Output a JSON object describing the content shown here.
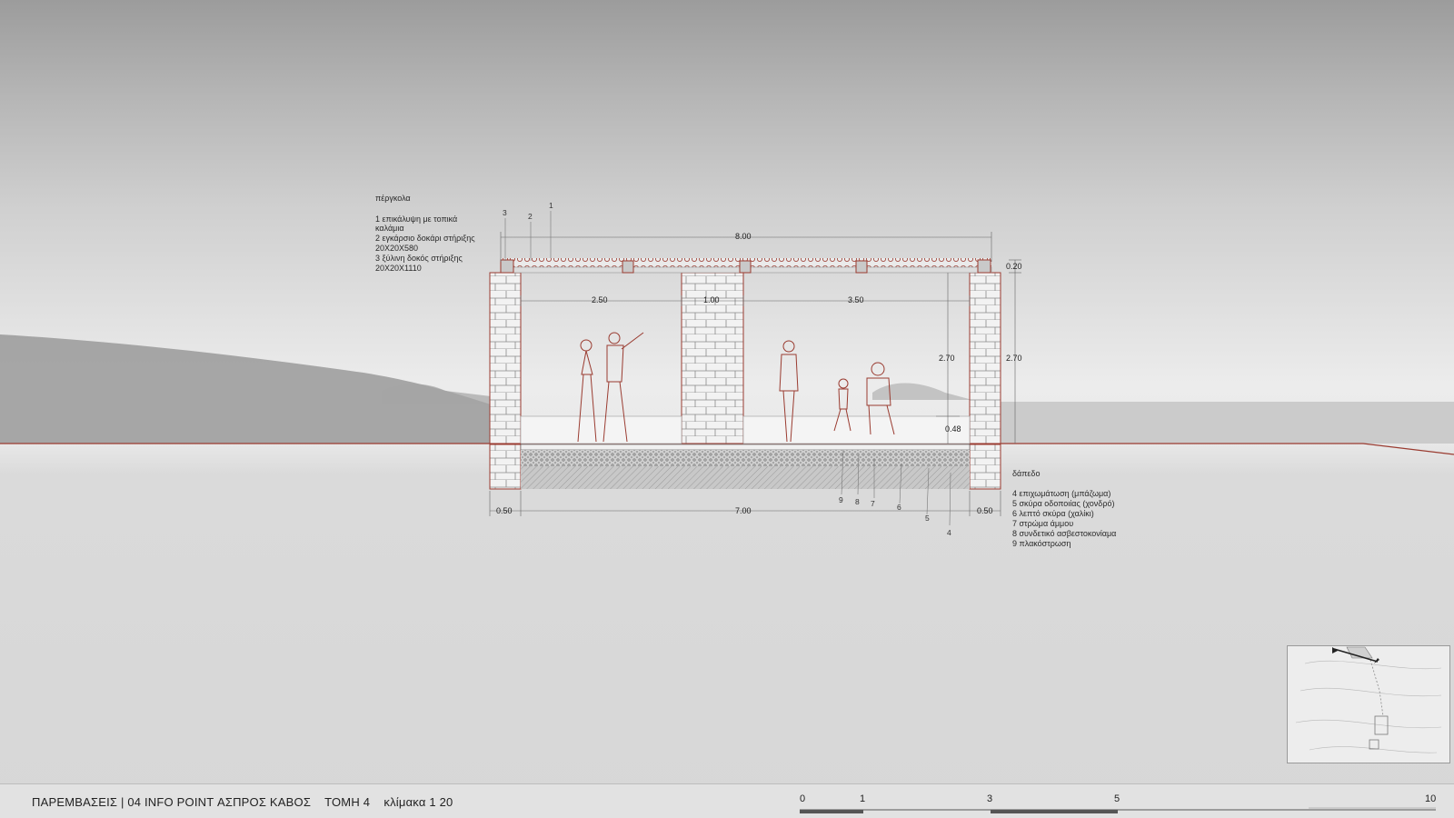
{
  "sheet": {
    "title": "ΠΑΡΕΜΒΑΣΕΙΣ | 04 INFO POINT ΑΣΠΡΟΣ ΚΑΒΟΣ",
    "section": "ΤΟΜΗ 4",
    "scale": "κλίμακα 1 20"
  },
  "scale_bar": {
    "ticks": [
      "0",
      "1",
      "3",
      "5",
      "10"
    ]
  },
  "pergola_legend": {
    "heading": "πέργκολα",
    "items": [
      "1 επικάλυψη με τοπικά",
      "καλάμια",
      "2 εγκάρσιο δοκάρι στήριξης",
      "20Χ20Χ580",
      "3 ξύλινη δοκός στήριξης",
      "20Χ20Χ1110"
    ]
  },
  "floor_legend": {
    "heading": "δάπεδο",
    "items": [
      "4 επιχωμάτωση (μπάζωμα)",
      "5  σκύρα οδοποιίας (χονδρό)",
      "6 λεπτό σκύρα (χαλίκι)",
      "7 στρώμα άμμου",
      "8 συνδετικό ασβεστοκονίαμα",
      "9 πλακόστρωση"
    ]
  },
  "dimensions": {
    "total_width": "8.00",
    "span_left": "2.50",
    "pillar": "1.00",
    "span_right": "3.50",
    "height_inner": "2.70",
    "height_outer": "2.70",
    "roof": "0.20",
    "bench": "0.48",
    "wall_left": "0.50",
    "inner_width": "7.00",
    "wall_right": "0.50"
  },
  "callouts": {
    "top": [
      "3",
      "2",
      "1"
    ],
    "bottom": [
      "9",
      "8",
      "7",
      "6",
      "5",
      "4"
    ]
  },
  "colors": {
    "section_line": "#9a3b30",
    "background": "#d7d7d7"
  }
}
